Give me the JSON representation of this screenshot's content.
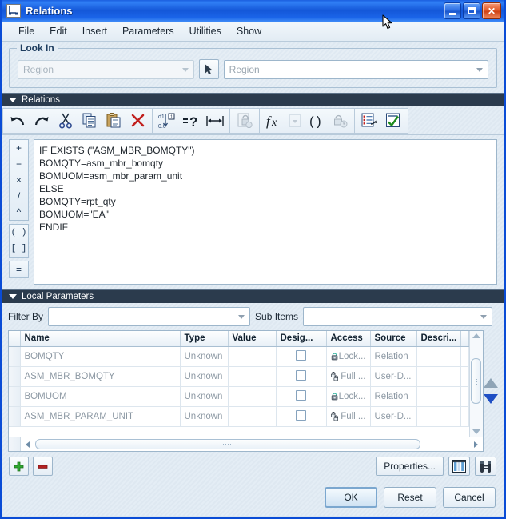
{
  "window": {
    "title": "Relations",
    "icon": "relations-window-icon",
    "buttons": {
      "minimize": "minimize",
      "maximize": "maximize",
      "close": "close"
    }
  },
  "menubar": {
    "items": [
      "File",
      "Edit",
      "Insert",
      "Parameters",
      "Utilities",
      "Show"
    ]
  },
  "lookin": {
    "title": "Look In",
    "left_combo": {
      "value": "Region",
      "disabled": true
    },
    "picker_icon": "pointer-select-icon",
    "right_combo": {
      "value": "Region",
      "disabled": false
    }
  },
  "relations_section": {
    "title": "Relations",
    "collapse_icon": "triangle-down-icon",
    "toolbar": [
      {
        "name": "undo",
        "icon": "undo-arrow-icon",
        "disabled": false
      },
      {
        "name": "redo",
        "icon": "redo-arrow-icon",
        "disabled": false
      },
      {
        "name": "cut",
        "icon": "scissors-icon",
        "disabled": false
      },
      {
        "name": "copy",
        "icon": "copy-pages-icon",
        "disabled": false
      },
      {
        "name": "paste",
        "icon": "clipboard-paste-icon",
        "disabled": false
      },
      {
        "name": "delete",
        "icon": "red-x-icon",
        "disabled": false
      },
      {
        "name": "sort",
        "icon": "sort-ascending-icon",
        "disabled": false
      },
      {
        "name": "evaluate",
        "icon": "equals-question-icon",
        "disabled": false
      },
      {
        "name": "measure",
        "icon": "dimension-arrows-icon",
        "disabled": false
      },
      {
        "name": "lock-relation",
        "icon": "locked-sheet-icon",
        "disabled": true
      },
      {
        "name": "function",
        "icon": "fx-icon",
        "disabled": false
      },
      {
        "name": "function-dropdown",
        "icon": "chevron-down-icon",
        "disabled": true
      },
      {
        "name": "parentheses",
        "icon": "parentheses-icon",
        "disabled": false
      },
      {
        "name": "history",
        "icon": "clock-lock-icon",
        "disabled": true
      },
      {
        "name": "insert-from-list",
        "icon": "list-insert-icon",
        "disabled": false
      },
      {
        "name": "verify",
        "icon": "green-check-sheet-icon",
        "disabled": false
      }
    ],
    "gutter": {
      "operators": [
        "+",
        "−",
        "×",
        "/",
        "^"
      ],
      "brackets": [
        "( )",
        "[ ]"
      ],
      "equals": [
        "="
      ]
    },
    "code": "IF EXISTS (\"ASM_MBR_BOMQTY\")\nBOMQTY=asm_mbr_bomqty\nBOMUOM=asm_mbr_param_unit\nELSE\nBOMQTY=rpt_qty\nBOMUOM=\"EA\"\nENDIF"
  },
  "local_parameters": {
    "title": "Local Parameters",
    "collapse_icon": "triangle-down-icon",
    "filter_by_label": "Filter By",
    "filter_by_value": "",
    "sub_items_label": "Sub Items",
    "sub_items_value": "",
    "columns": [
      "Name",
      "Type",
      "Value",
      "Desig...",
      "Access",
      "Source",
      "Descri...",
      ""
    ],
    "rows": [
      {
        "name": "BOMQTY",
        "type": "Unknown",
        "value": "",
        "designate": false,
        "access": "Lock...",
        "access_icon": "locked-padlock-icon",
        "source": "Relation",
        "description": ""
      },
      {
        "name": "ASM_MBR_BOMQTY",
        "type": "Unknown",
        "value": "",
        "designate": false,
        "access": "Full ...",
        "access_icon": "unlocked-padlocks-icon",
        "source": "User-D...",
        "description": ""
      },
      {
        "name": "BOMUOM",
        "type": "Unknown",
        "value": "",
        "designate": false,
        "access": "Lock...",
        "access_icon": "locked-padlock-icon",
        "source": "Relation",
        "description": ""
      },
      {
        "name": "ASM_MBR_PARAM_UNIT",
        "type": "Unknown",
        "value": "",
        "designate": false,
        "access": "Full ...",
        "access_icon": "unlocked-padlocks-icon",
        "source": "User-D...",
        "description": ""
      }
    ],
    "move_up_icon": "move-up-triangle-icon",
    "move_down_icon": "move-down-triangle-icon",
    "add_icon": "green-plus-icon",
    "remove_icon": "red-minus-icon",
    "properties_label": "Properties...",
    "columns_icon": "column-layout-icon",
    "find_icon": "binoculars-icon"
  },
  "footer": {
    "ok_label": "OK",
    "reset_label": "Reset",
    "cancel_label": "Cancel"
  },
  "colors": {
    "titlebar_blue": "#1457d8",
    "window_border": "#0a4cd6",
    "section_header": "#2b3b4d",
    "accent_blue": "#1f4fc4",
    "green": "#2a9d2a",
    "red": "#c02020"
  }
}
